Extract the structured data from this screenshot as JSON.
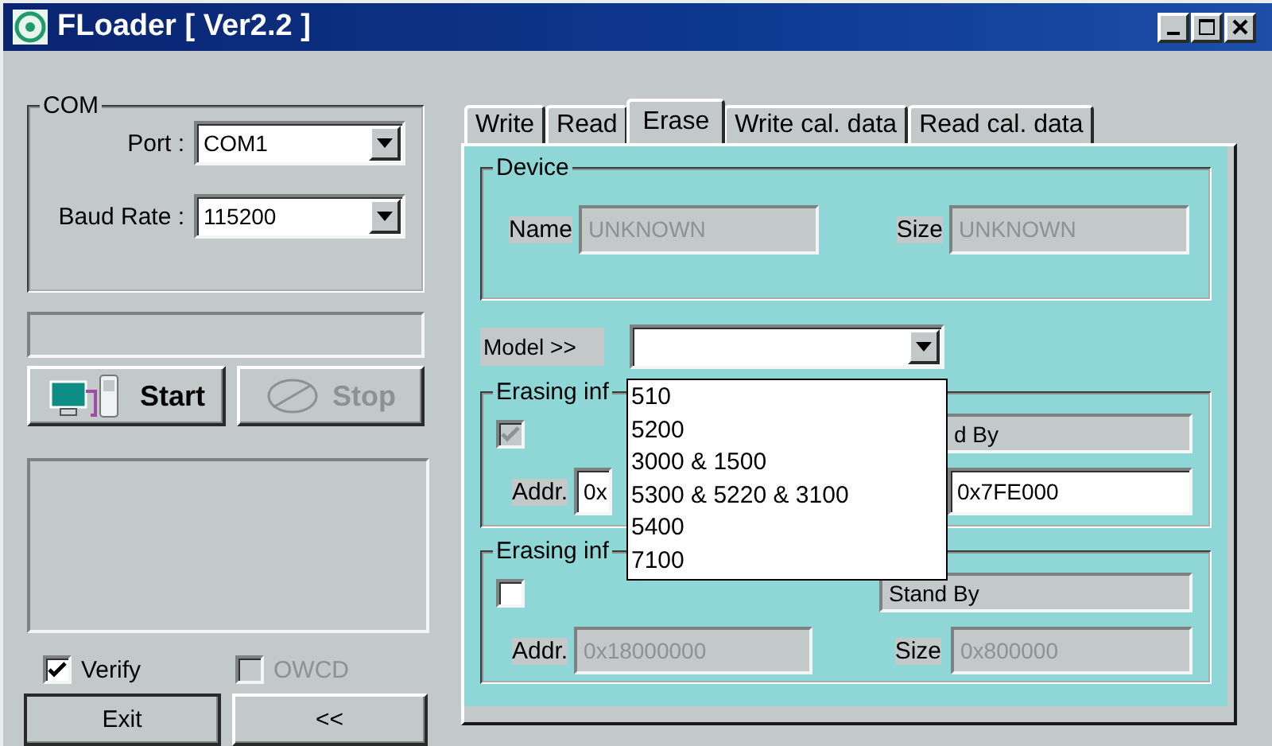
{
  "window": {
    "title": "FLoader [ Ver2.2 ]"
  },
  "com": {
    "title": "COM",
    "port": {
      "label": "Port :",
      "value": "COM1"
    },
    "baud_rate": {
      "label": "Baud Rate :",
      "value": "115200"
    }
  },
  "action_buttons": [
    {
      "kind": "start",
      "label": "Start",
      "disabled": false
    },
    {
      "kind": "stop",
      "label": "Stop",
      "disabled": true
    }
  ],
  "options": [
    {
      "label": "Verify",
      "checked": true,
      "disabled": false
    },
    {
      "label": "OWCD",
      "checked": false,
      "disabled": true
    }
  ],
  "footer_buttons": [
    "Exit",
    "<<"
  ],
  "tabs": [
    {
      "label": "Write",
      "selected": false
    },
    {
      "label": "Read",
      "selected": false
    },
    {
      "label": "Erase",
      "selected": true
    },
    {
      "label": "Write cal. data",
      "selected": false
    },
    {
      "label": "Read cal. data",
      "selected": false
    }
  ],
  "device": {
    "title": "Device",
    "name": {
      "label": "Name",
      "value": "UNKNOWN",
      "disabled": true
    },
    "size": {
      "label": "Size",
      "value": "UNKNOWN",
      "disabled": true
    }
  },
  "model": {
    "label": "Model >>",
    "options": [
      "510",
      "5200",
      "3000 & 1500",
      "5300 & 5220 & 3100",
      "5400",
      "7100"
    ]
  },
  "erasing_groups": [
    {
      "title": "Erasing inf",
      "checked": true,
      "disabled": true,
      "status": "d By",
      "addr_label": "Addr.",
      "addr": {
        "value": "0x",
        "disabled": false
      },
      "size": {
        "value": "0x7FE000",
        "disabled": false
      }
    },
    {
      "title": "Erasing inf",
      "checked": false,
      "disabled": false,
      "status": "Stand By",
      "addr_label": "Addr.",
      "addr": {
        "value": "0x18000000",
        "disabled": true
      },
      "size_label": "Size",
      "size": {
        "value": "0x800000",
        "disabled": true
      }
    }
  ]
}
